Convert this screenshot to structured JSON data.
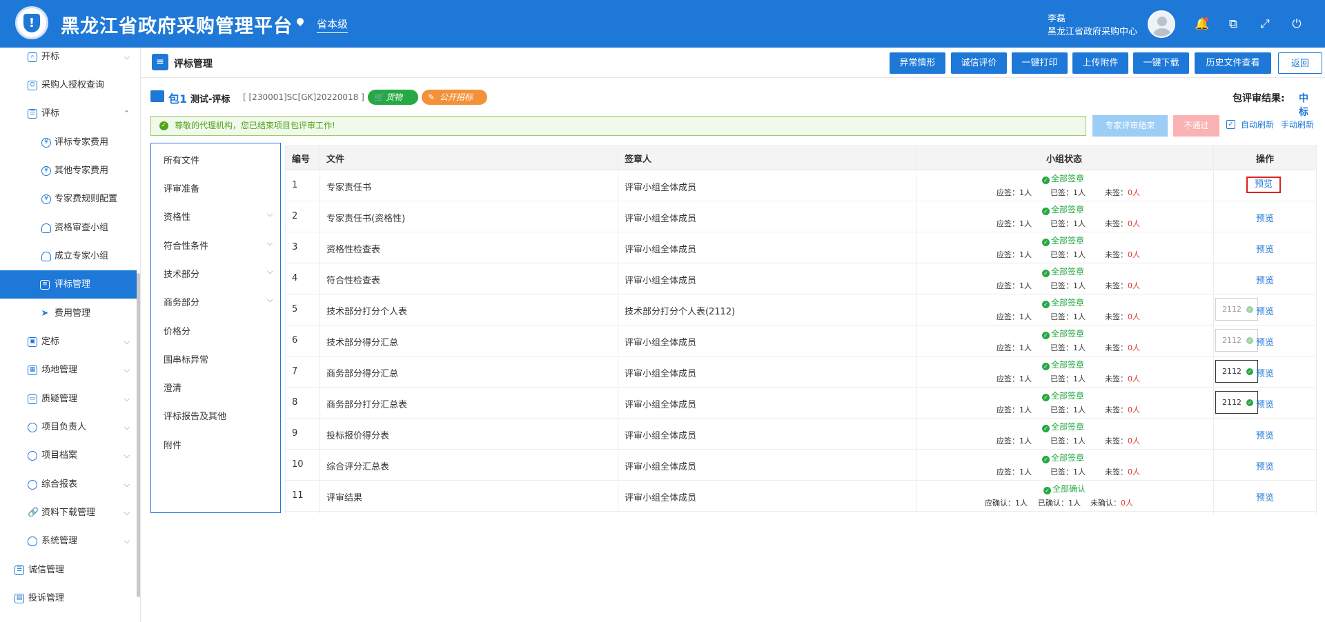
{
  "header": {
    "logo_icon": "shield-icon",
    "title": "黑龙江省政府采购管理平台",
    "location": "省本级",
    "user_name": "李磊",
    "user_org": "黑龙江省政府采购中心"
  },
  "sidebar": {
    "items": [
      {
        "label": "开标",
        "icon": "gavel-icon",
        "expanded": false
      },
      {
        "label": "采购人授权查询",
        "icon": "shield-search-icon"
      },
      {
        "label": "评标",
        "icon": "document-icon",
        "expanded": true
      },
      {
        "label": "评标专家费用",
        "icon": "yen-icon"
      },
      {
        "label": "其他专家费用",
        "icon": "yen-icon"
      },
      {
        "label": "专家费规则配置",
        "icon": "yen-icon"
      },
      {
        "label": "资格审查小组",
        "icon": "user-icon"
      },
      {
        "label": "成立专家小组",
        "icon": "user-icon"
      },
      {
        "label": "评标管理",
        "icon": "layers-icon",
        "active": true
      },
      {
        "label": "费用管理",
        "icon": "send-icon"
      },
      {
        "label": "定标",
        "icon": "calendar-icon"
      },
      {
        "label": "场地管理",
        "icon": "building-icon"
      },
      {
        "label": "质疑管理",
        "icon": "briefcase-icon"
      },
      {
        "label": "项目负责人",
        "icon": "person-circle-icon"
      },
      {
        "label": "项目档案",
        "icon": "person-circle-icon"
      },
      {
        "label": "综合报表",
        "icon": "chart-circle-icon"
      },
      {
        "label": "资料下载管理",
        "icon": "link-icon"
      },
      {
        "label": "系统管理",
        "icon": "shield-gear-icon"
      },
      {
        "label": "诚信管理",
        "icon": "list-icon"
      },
      {
        "label": "投诉管理",
        "icon": "complaint-icon"
      }
    ]
  },
  "topbar": {
    "page_title": "评标管理",
    "buttons": [
      "异常情形",
      "诚信评价",
      "一键打印",
      "上传附件",
      "一键下载",
      "历史文件查看"
    ],
    "back_label": "返回"
  },
  "package": {
    "number": "包1",
    "name": "测试-评标",
    "code": "[ [230001]SC[GK]20220018 ]",
    "tag_type": "货物",
    "tag_method": "公开招标",
    "result_label": "包评审结果:",
    "result_value": "中标"
  },
  "notice": {
    "text": "尊敬的代理机构，您已结束项目包评审工作!",
    "end_button": "专家评审结束",
    "fail_button": "不通过",
    "auto_refresh": "自动刷新",
    "manual_refresh": "手动刷新",
    "auto_refresh_checked": true
  },
  "categories": [
    "所有文件",
    "评审准备",
    "资格性",
    "符合性条件",
    "技术部分",
    "商务部分",
    "价格分",
    "围串标异常",
    "澄清",
    "评标报告及其他",
    "附件"
  ],
  "table": {
    "columns": [
      "编号",
      "文件",
      "签章人",
      "小组状态",
      "操作"
    ],
    "rows": [
      {
        "no": "1",
        "file": "专家责任书",
        "signer": "评审小组全体成员",
        "status": "全部签章",
        "should": "应签：1人",
        "done": "已签：1人",
        "pending_label": "未签：",
        "pending_val": "0人",
        "action": "预览"
      },
      {
        "no": "2",
        "file": "专家责任书(资格性)",
        "signer": "评审小组全体成员",
        "status": "全部签章",
        "should": "应签：1人",
        "done": "已签：1人",
        "pending_label": "未签：",
        "pending_val": "0人",
        "action": "预览"
      },
      {
        "no": "3",
        "file": "资格性检查表",
        "signer": "评审小组全体成员",
        "status": "全部签章",
        "should": "应签：1人",
        "done": "已签：1人",
        "pending_label": "未签：",
        "pending_val": "0人",
        "action": "预览"
      },
      {
        "no": "4",
        "file": "符合性检查表",
        "signer": "评审小组全体成员",
        "status": "全部签章",
        "should": "应签：1人",
        "done": "已签：1人",
        "pending_label": "未签：",
        "pending_val": "0人",
        "action": "预览"
      },
      {
        "no": "5",
        "file": "技术部分打分个人表",
        "signer": "技术部分打分个人表(2112)",
        "status": "全部签章",
        "should": "应签：1人",
        "done": "已签：1人",
        "pending_label": "未签：",
        "pending_val": "0人",
        "action": "预览",
        "popup": "2112"
      },
      {
        "no": "6",
        "file": "技术部分得分汇总",
        "signer": "评审小组全体成员",
        "status": "全部签章",
        "should": "应签：1人",
        "done": "已签：1人",
        "pending_label": "未签：",
        "pending_val": "0人",
        "action": "预览",
        "popup": "2112"
      },
      {
        "no": "7",
        "file": "商务部分得分汇总",
        "signer": "评审小组全体成员",
        "status": "全部签章",
        "should": "应签：1人",
        "done": "已签：1人",
        "pending_label": "未签：",
        "pending_val": "0人",
        "action": "预览",
        "popup": "2112"
      },
      {
        "no": "8",
        "file": "商务部分打分汇总表",
        "signer": "评审小组全体成员",
        "status": "全部签章",
        "should": "应签：1人",
        "done": "已签：1人",
        "pending_label": "未签：",
        "pending_val": "0人",
        "action": "预览",
        "popup": "2112"
      },
      {
        "no": "9",
        "file": "投标报价得分表",
        "signer": "评审小组全体成员",
        "status": "全部签章",
        "should": "应签：1人",
        "done": "已签：1人",
        "pending_label": "未签：",
        "pending_val": "0人",
        "action": "预览"
      },
      {
        "no": "10",
        "file": "综合评分汇总表",
        "signer": "评审小组全体成员",
        "status": "全部签章",
        "should": "应签：1人",
        "done": "已签：1人",
        "pending_label": "未签：",
        "pending_val": "0人",
        "action": "预览"
      },
      {
        "no": "11",
        "file": "评审结果",
        "signer": "评审小组全体成员",
        "status": "全部确认",
        "should": "应确认：1人",
        "done": "已确认：1人",
        "pending_label": "未确认：",
        "pending_val": "0人",
        "action": "预览"
      }
    ]
  },
  "colors": {
    "primary": "#1e78d7",
    "success": "#27a844",
    "danger": "#e0392c",
    "tag_orange": "#f3913a"
  }
}
